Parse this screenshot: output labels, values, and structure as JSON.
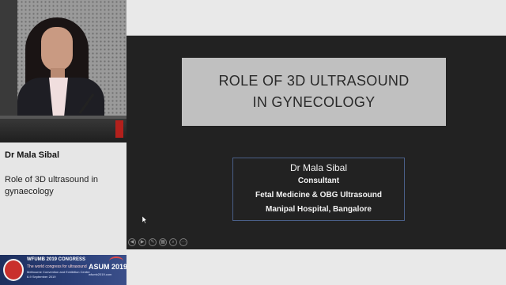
{
  "speaker": {
    "name": "Dr Mala Sibal",
    "talk_title": "Role of 3D ultrasound in gynaecology"
  },
  "slide": {
    "title": "ROLE OF 3D ULTRASOUND IN GYNECOLOGY",
    "author_name": "Dr Mala Sibal",
    "author_role": "Consultant",
    "author_dept": "Fetal Medicine & OBG Ultrasound",
    "author_affiliation": "Manipal Hospital, Bangalore"
  },
  "banner": {
    "line1": "WFUMB 2019 CONGRESS",
    "line2": "The world congress for ultrasound",
    "line3": "Melbourne Convention and Exhibition Centre",
    "line4": "6-9 September 2019",
    "asum": "ASUM 2019",
    "asum_sub": "wfumb2019.com"
  },
  "controls": [
    {
      "icon": "previous-icon",
      "glyph": "◀"
    },
    {
      "icon": "next-icon",
      "glyph": "▶"
    },
    {
      "icon": "pen-icon",
      "glyph": "✎"
    },
    {
      "icon": "slides-icon",
      "glyph": "▦"
    },
    {
      "icon": "zoom-icon",
      "glyph": "⌕"
    },
    {
      "icon": "more-options-icon",
      "glyph": "⋯"
    }
  ],
  "colors": {
    "slide_background": "#222222",
    "title_box": "#c0c0c0",
    "author_box_border": "#4a5f88",
    "banner_blue": "#1d2f5e"
  }
}
